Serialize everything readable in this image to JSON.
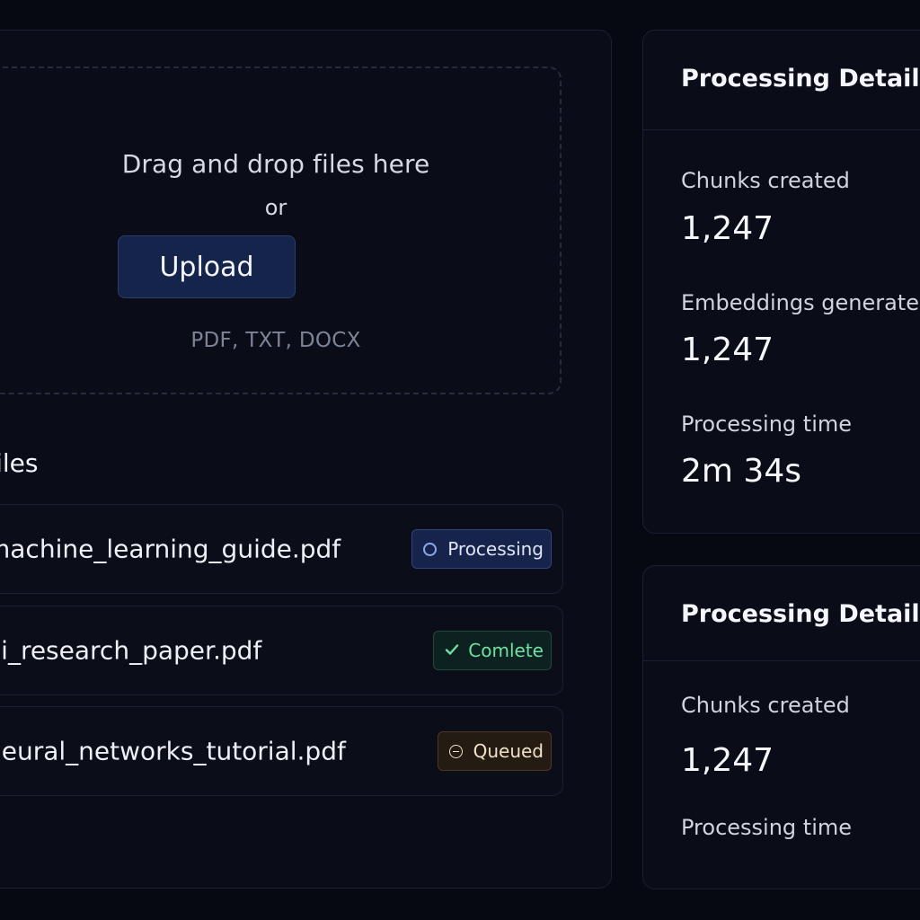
{
  "upload": {
    "dropzone_title": "Drag and drop files here",
    "or_text": "or",
    "upload_button": "Upload",
    "file_types": "PDF, TXT, DOCX"
  },
  "files": {
    "heading": "Files",
    "items": [
      {
        "name": "machine_learning_guide.pdf",
        "status": "Processing",
        "status_icon": "circle-icon"
      },
      {
        "name": "ai_research_paper.pdf",
        "status": "Comlete",
        "status_icon": "check-icon"
      },
      {
        "name": "neural_networks_tutorial.pdf",
        "status": "Queued",
        "status_icon": "minus-circle-icon"
      }
    ]
  },
  "details_top": {
    "title": "Processing Details",
    "chunks_label": "Chunks created",
    "chunks_value": "1,247",
    "embeddings_label": "Embeddings generated",
    "embeddings_value": "1,247",
    "time_label": "Processing time",
    "time_value": "2m 34s"
  },
  "details_bottom": {
    "title": "Processing Details",
    "chunks_label": "Chunks created",
    "chunks_value": "1,247",
    "time_label": "Processing time"
  },
  "colors": {
    "background": "#070912",
    "panel": "#0a0d17",
    "upload_button": "#15244a",
    "processing_badge": "#16244b",
    "complete_badge": "#0d2220",
    "complete_text": "#6fe0a4",
    "queued_badge": "#241c13"
  }
}
